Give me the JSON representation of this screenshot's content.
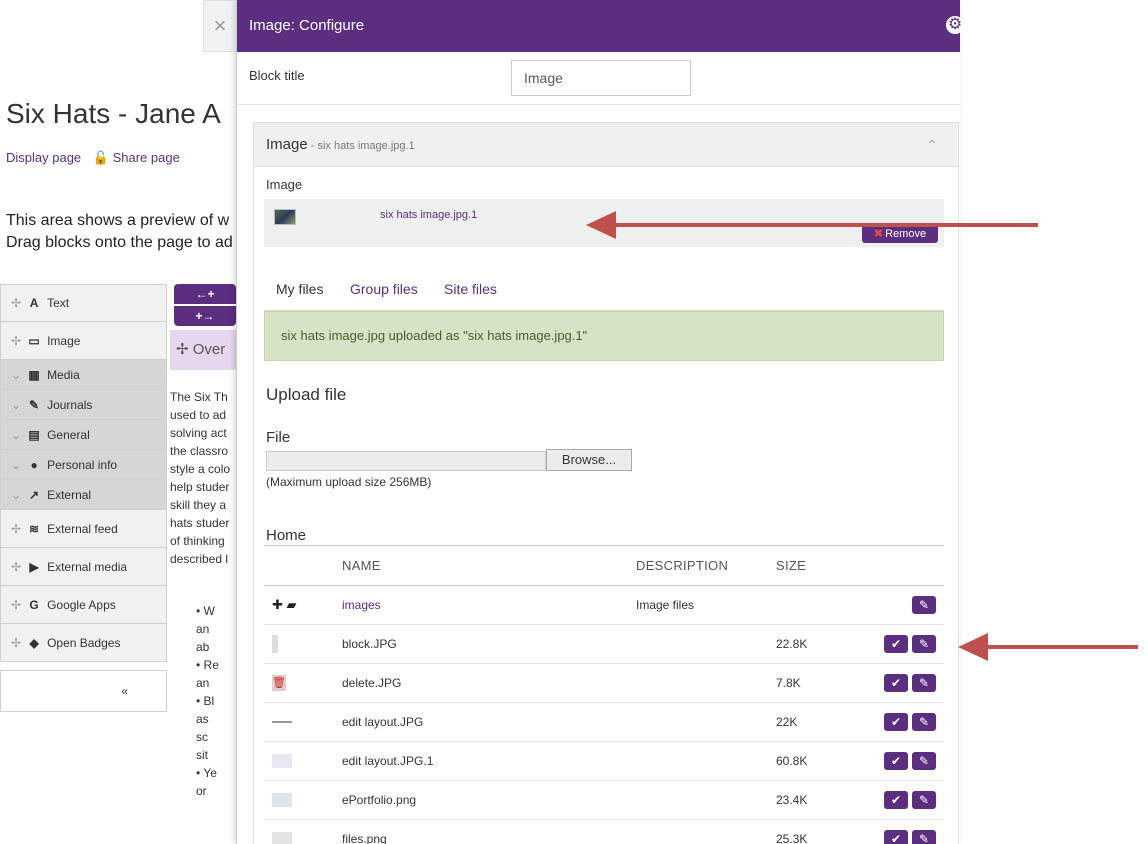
{
  "background": {
    "close_icon": "×",
    "page_title": "Six Hats - Jane A",
    "display_link": "Display page",
    "share_link": "Share page",
    "intro_line1": "This area shows a preview of w",
    "intro_line2": "Drag blocks onto the page to ad",
    "blocks": [
      {
        "label": "Text",
        "icon": "A"
      },
      {
        "label": "Image",
        "icon": "▭"
      },
      {
        "label": "Media",
        "icon": "▦"
      },
      {
        "label": "Journals",
        "icon": "✎"
      },
      {
        "label": "General",
        "icon": "▤"
      },
      {
        "label": "Personal info",
        "icon": "●"
      },
      {
        "label": "External",
        "icon": "↗"
      },
      {
        "label": "External feed",
        "icon": "≋"
      },
      {
        "label": "External media",
        "icon": "▶"
      },
      {
        "label": "Google Apps",
        "icon": "G"
      },
      {
        "label": "Open Badges",
        "icon": "◆"
      }
    ],
    "collapse_icon": "«",
    "arrow_btn1": "←+",
    "arrow_btn2": "+→",
    "overview": "Over",
    "body_lines": [
      "The Six Th",
      "used to ad",
      "solving act",
      "the classro",
      "style a colo",
      "help studer",
      "skill they a",
      "hats studer",
      "of thinking",
      "described l"
    ],
    "bullet_lines": [
      "• W",
      "an",
      "ab",
      "• Re",
      "an",
      "• Bl",
      "as",
      "sc",
      "sit",
      "• Ye",
      "or"
    ]
  },
  "modal": {
    "title": "Image: Configure",
    "block_title_label": "Block title",
    "block_title_value": "Image",
    "panel_title": "Image",
    "panel_subtitle": " - six hats image.jpg.1",
    "image_label": "Image",
    "selected_image": "six hats image.jpg.1",
    "remove_label": "Remove",
    "tabs": [
      "My files",
      "Group files",
      "Site files"
    ],
    "alert": "six hats image.jpg uploaded as \"six hats image.jpg.1\"",
    "upload_heading": "Upload file",
    "file_label": "File",
    "browse_label": "Browse...",
    "max_upload": "(Maximum upload size 256MB)",
    "home_label": "Home",
    "columns": {
      "name": "NAME",
      "description": "DESCRIPTION",
      "size": "SIZE"
    },
    "files": [
      {
        "name": "images",
        "description": "Image files",
        "size": "",
        "folder": true
      },
      {
        "name": "block.JPG",
        "description": "",
        "size": "22.8K",
        "folder": false
      },
      {
        "name": "delete.JPG",
        "description": "",
        "size": "7.8K",
        "folder": false
      },
      {
        "name": "edit layout.JPG",
        "description": "",
        "size": "22K",
        "folder": false
      },
      {
        "name": "edit layout.JPG.1",
        "description": "",
        "size": "60.8K",
        "folder": false
      },
      {
        "name": "ePortfolio.png",
        "description": "",
        "size": "23.4K",
        "folder": false
      },
      {
        "name": "files.png",
        "description": "",
        "size": "25.3K",
        "folder": false
      }
    ]
  },
  "colors": {
    "accent": "#5b2e7f",
    "alert_bg": "#d7e3c6",
    "arrow": "#c0504d"
  }
}
